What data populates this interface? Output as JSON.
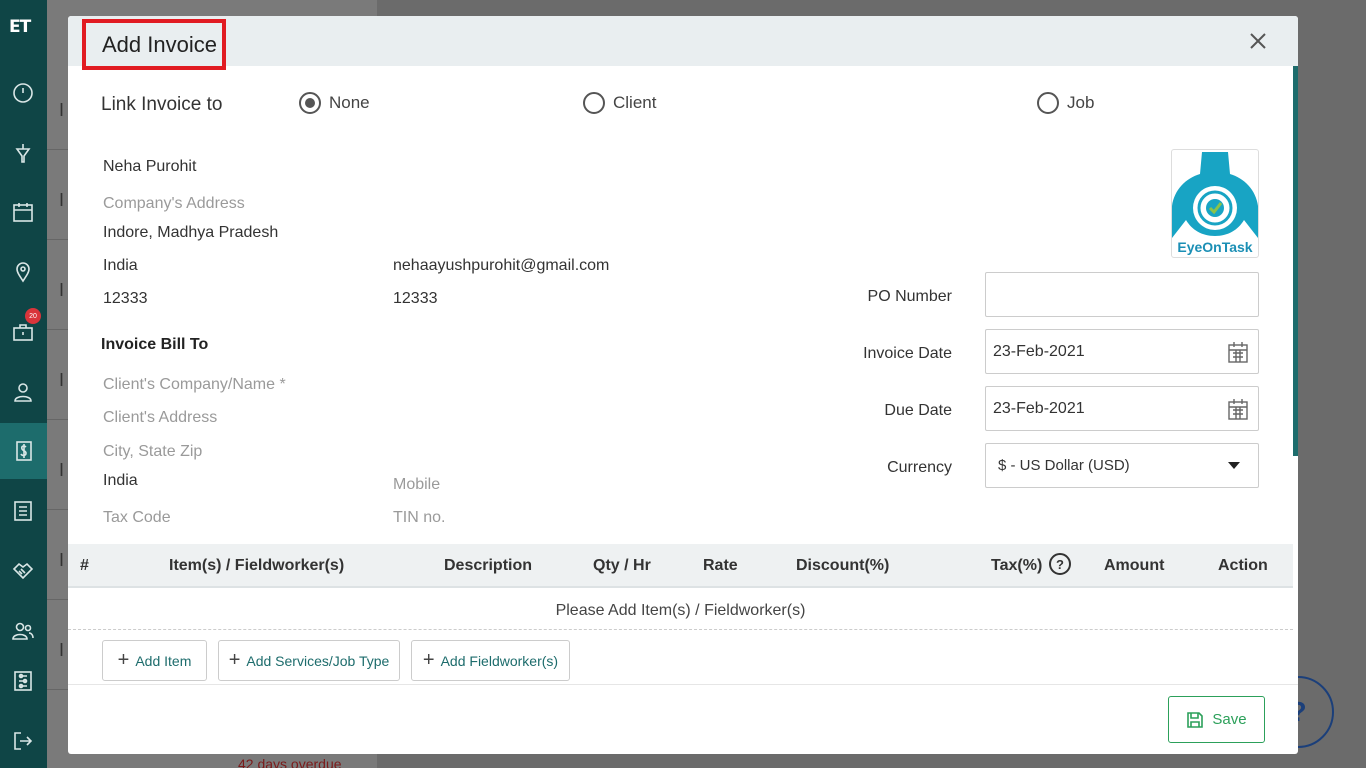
{
  "sidebar": {
    "logo": "ET",
    "badge": "20",
    "icons": [
      "dashboard-icon",
      "funnel-icon",
      "calendar-icon",
      "map-pin-icon",
      "briefcase-icon",
      "user-icon",
      "invoice-dollar-icon",
      "list-icon",
      "handshake-icon",
      "users-icon",
      "settings-sliders-icon",
      "logout-icon"
    ]
  },
  "background": {
    "row_letters": [
      "I",
      "I",
      "I",
      "I",
      "I",
      "I",
      "I"
    ],
    "overdue": "42 days overdue",
    "help": "?"
  },
  "modal": {
    "title": "Add Invoice",
    "link_label": "Link Invoice to",
    "radios": [
      {
        "label": "None",
        "selected": true
      },
      {
        "label": "Client",
        "selected": false
      },
      {
        "label": "Job",
        "selected": false
      }
    ],
    "company": {
      "name": "Neha Purohit",
      "address_placeholder": "Company's Address",
      "city_state": "Indore, Madhya Pradesh",
      "country": "India",
      "zip": "12333",
      "email": "nehaayushpurohit@gmail.com",
      "phone": "12333"
    },
    "bill_to": {
      "heading": "Invoice Bill To",
      "client_name_placeholder": "Client's Company/Name *",
      "client_address_placeholder": "Client's Address",
      "city_state_zip_placeholder": "City, State Zip",
      "country": "India",
      "mobile_placeholder": "Mobile",
      "tax_code_placeholder": "Tax Code",
      "tin_placeholder": "TIN no."
    },
    "logo_text": "EyeOnTask",
    "fields": {
      "po_label": "PO Number",
      "po_value": "",
      "invoice_date_label": "Invoice Date",
      "invoice_date": "23-Feb-2021",
      "due_date_label": "Due Date",
      "due_date": "23-Feb-2021",
      "currency_label": "Currency",
      "currency": "$ - US Dollar (USD)"
    },
    "table": {
      "headers": [
        "#",
        "Item(s) / Fieldworker(s)",
        "Description",
        "Qty / Hr",
        "Rate",
        "Discount(%)",
        "Tax(%)",
        "Amount",
        "Action"
      ],
      "tax_help": "?",
      "empty": "Please Add Item(s) / Fieldworker(s)"
    },
    "buttons": {
      "add_item": "Add Item",
      "add_services": "Add Services/Job Type",
      "add_fieldworker": "Add Fieldworker(s)",
      "save": "Save"
    }
  },
  "colors": {
    "sidebar": "#0f4546",
    "accent": "#1d6c6c",
    "highlight": "#e11b22",
    "save": "#2ca05a"
  }
}
